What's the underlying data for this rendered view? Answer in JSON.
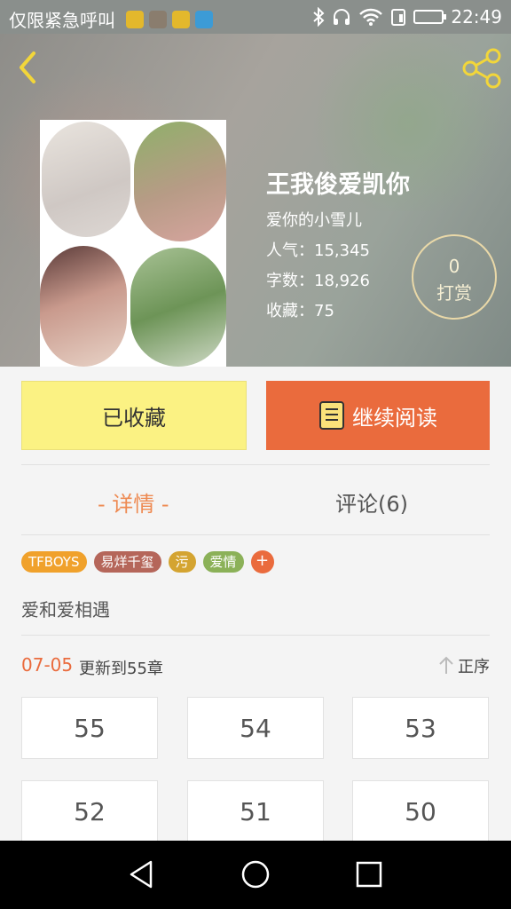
{
  "status_bar": {
    "carrier": "仅限紧急呼叫",
    "time": "22:49",
    "icons": [
      "bluetooth-icon",
      "headphones-icon",
      "wifi-icon",
      "sim-icon",
      "battery-icon"
    ]
  },
  "header": {
    "back_icon": "chevron-left-icon",
    "share_icon": "share-icon"
  },
  "book": {
    "title": "王我俊爱凯你",
    "author": "爱你的小雪儿",
    "popularity": "人气：15,345",
    "word_count": "字数：18,926",
    "favorites": "收藏：75",
    "reward_count": "0",
    "reward_label": "打赏"
  },
  "actions": {
    "favorited_label": "已收藏",
    "continue_label": "继续阅读"
  },
  "tabs": {
    "detail": "- 详情 -",
    "comments": "评论(6)"
  },
  "tags": [
    {
      "label": "TFBOYS",
      "color": "#f0a12b"
    },
    {
      "label": "易烊千玺",
      "color": "#b5665a"
    },
    {
      "label": "污",
      "color": "#d4a431"
    },
    {
      "label": "爱情",
      "color": "#8bb158"
    }
  ],
  "tag_add_label": "+",
  "summary": "爱和爱相遇",
  "update": {
    "date": "07-05",
    "text": "更新到55章",
    "order_label": "正序"
  },
  "chapters": [
    "55",
    "54",
    "53",
    "52",
    "51",
    "50"
  ],
  "colors": {
    "accent": "#ea6b3d",
    "favorite_bg": "#fbf283",
    "tab_active": "#ee8a52"
  }
}
